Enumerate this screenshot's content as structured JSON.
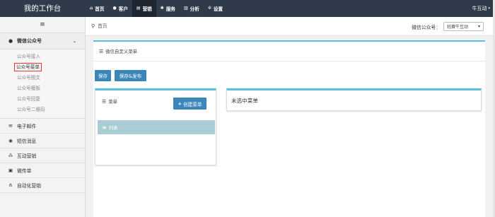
{
  "app": {
    "brand": "我的工作台"
  },
  "nav": {
    "items": [
      {
        "icon": "home-icon",
        "glyph": "⌂",
        "label": "首页"
      },
      {
        "icon": "user-icon",
        "glyph": "●",
        "label": "客户"
      },
      {
        "icon": "book-icon",
        "glyph": "▤",
        "label": "营销"
      },
      {
        "icon": "cogs-icon",
        "glyph": "✱",
        "label": "服务"
      },
      {
        "icon": "bar-chart-icon",
        "glyph": "▥",
        "label": "分析"
      },
      {
        "icon": "gear-icon",
        "glyph": "✲",
        "label": "设置"
      }
    ],
    "active_index": 2,
    "user_name": "牛互动",
    "user_caret": "▾"
  },
  "sidebar": {
    "toggle": "≡",
    "wechat_section": {
      "icon": "wechat-icon",
      "label": "微信公众号",
      "chevron": "⌄"
    },
    "wechat_items": [
      {
        "label": "公众号接入"
      },
      {
        "label": "公众号菜单"
      },
      {
        "label": "公众号图文"
      },
      {
        "label": "公众号模板"
      },
      {
        "label": "公众号回复"
      },
      {
        "label": "公众号二维码"
      }
    ],
    "selected_index": 1,
    "links": [
      {
        "icon": "envelope-icon",
        "glyph": "✉",
        "label": "电子邮件"
      },
      {
        "icon": "chat-icon",
        "glyph": "◉",
        "label": "短信消息"
      },
      {
        "icon": "interact-icon",
        "glyph": "⁂",
        "label": "互动营销"
      },
      {
        "icon": "flyer-icon",
        "glyph": "▣",
        "label": "微传单"
      },
      {
        "icon": "sitemap-icon",
        "glyph": "⋔",
        "label": "自动化营销"
      }
    ]
  },
  "breadcrumb": {
    "icon": "map-marker-icon",
    "label": "首页"
  },
  "account": {
    "label": "微信公众号：",
    "selected": "轻赛牛互动",
    "arrow": "▾"
  },
  "page": {
    "title": "微信自定义菜单"
  },
  "toolbar": {
    "save_label": "保存",
    "publish_label": "保存&发布"
  },
  "menu_panel": {
    "title": "菜单",
    "create_label": "创建菜单",
    "list_label": "列表"
  },
  "detail_panel": {
    "empty_text": "未选中菜单"
  },
  "colors": {
    "navbar": "#2f3b4a",
    "accent": "#3a86b8",
    "panel_top": "#5bc0de",
    "selection": "#e33333",
    "list_row": "#a8cdd2"
  }
}
